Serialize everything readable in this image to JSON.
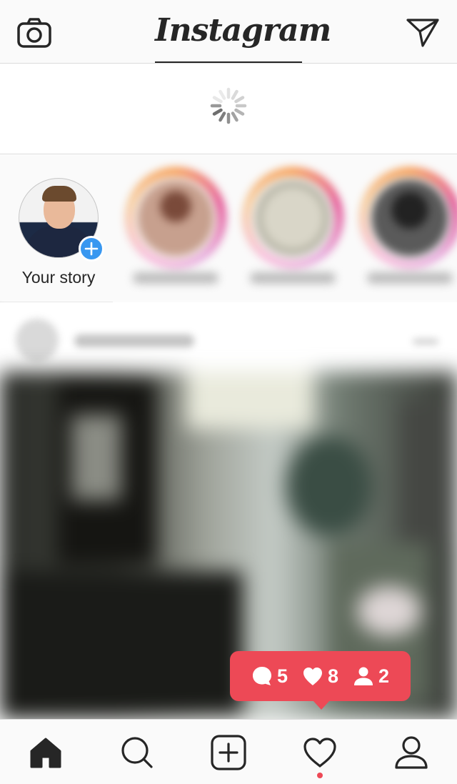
{
  "header": {
    "logo_text": "Instagram",
    "left_icon": "camera-icon",
    "right_icon": "direct-message-icon"
  },
  "refresh": {
    "icon": "loading-spinner-icon"
  },
  "stories": {
    "own": {
      "label": "Your story",
      "badge_icon": "plus-icon"
    },
    "others_blurred_count": 3
  },
  "notification": {
    "comments": "5",
    "likes": "8",
    "followers": "2",
    "color": "#ed4956"
  },
  "tabbar": {
    "items": [
      "home-icon",
      "search-icon",
      "new-post-icon",
      "activity-heart-icon",
      "profile-icon"
    ],
    "active": "home-icon",
    "activity_dot_color": "#ed4956"
  },
  "colors": {
    "accent_blue": "#3897f0",
    "border": "#dbdbdb",
    "bar_background": "#fafafa"
  }
}
